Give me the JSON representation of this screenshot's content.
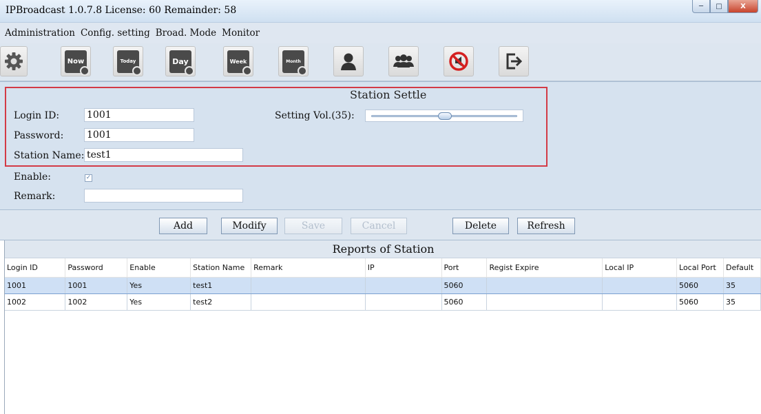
{
  "window": {
    "title": "IPBroadcast 1.0.7.8 License: 60 Remainder: 58",
    "controls": [
      "minimize",
      "maximize",
      "close"
    ]
  },
  "menu": [
    "Administration",
    "Config. setting",
    "Broad. Mode",
    "Monitor"
  ],
  "toolbar": {
    "icons": [
      "gear-icon",
      "calendar-now-icon",
      "calendar-today-icon",
      "calendar-day-icon",
      "calendar-week-icon",
      "calendar-month-icon",
      "user-icon",
      "group-icon",
      "mute-icon",
      "exit-icon"
    ],
    "cal_labels": [
      "Now",
      "Today",
      "Day",
      "Week",
      "Month"
    ]
  },
  "station": {
    "title": "Station Settle",
    "login_label": "Login ID:",
    "login_value": "1001",
    "password_label": "Password:",
    "password_value": "1001",
    "name_label": "Station Name:",
    "name_value": "test1",
    "volume_label": "Setting Vol.(35):",
    "volume_level": 0.5,
    "enable_label": "Enable:",
    "enable_checked": true,
    "remark_label": "Remark:",
    "remark_value": ""
  },
  "buttons": {
    "add": "Add",
    "modify": "Modify",
    "save": "Save",
    "cancel": "Cancel",
    "delete": "Delete",
    "refresh": "Refresh"
  },
  "reports": {
    "title": "Reports of Station",
    "columns": [
      "Login ID",
      "Password",
      "Enable",
      "Station Name",
      "Remark",
      "IP",
      "Port",
      "Regist Expire",
      "Local IP",
      "Local Port",
      "Default"
    ],
    "rows": [
      [
        "1001",
        "1001",
        "Yes",
        "test1",
        "",
        "",
        "5060",
        "",
        "",
        "5060",
        "35"
      ],
      [
        "1002",
        "1002",
        "Yes",
        "test2",
        "",
        "",
        "5060",
        "",
        "",
        "5060",
        "35"
      ]
    ],
    "selected_row": 0
  }
}
